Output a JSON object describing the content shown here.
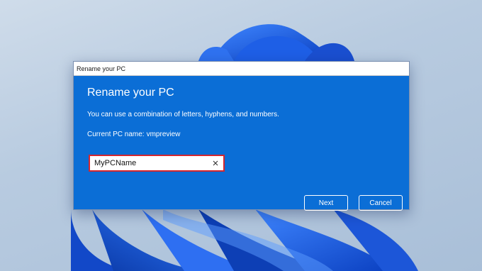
{
  "window": {
    "title": "Rename your PC"
  },
  "dialog": {
    "heading": "Rename your PC",
    "description": "You can use a combination of letters, hyphens, and numbers.",
    "current_label": "Current PC name:",
    "current_value": "vmpreview",
    "input_value": "MyPCName",
    "clear_icon": "close-icon",
    "next_label": "Next",
    "cancel_label": "Cancel"
  },
  "colors": {
    "dialog_blue": "#0b6ed6",
    "highlight_red": "#d3262f",
    "wallpaper_bloom": "#1f5fe0"
  }
}
